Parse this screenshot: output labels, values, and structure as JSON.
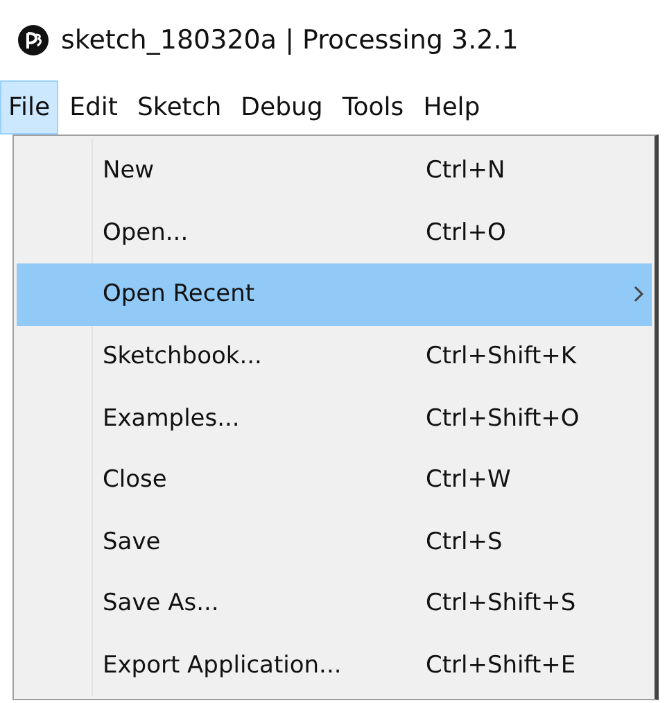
{
  "window": {
    "title": "sketch_180320a | Processing 3.2.1"
  },
  "menubar": [
    {
      "label": "File",
      "selected": true
    },
    {
      "label": "Edit",
      "selected": false
    },
    {
      "label": "Sketch",
      "selected": false
    },
    {
      "label": "Debug",
      "selected": false
    },
    {
      "label": "Tools",
      "selected": false
    },
    {
      "label": "Help",
      "selected": false
    }
  ],
  "menu": [
    {
      "label": "New",
      "shortcut": "Ctrl+N",
      "selected": false,
      "submenu": false
    },
    {
      "label": "Open...",
      "shortcut": "Ctrl+O",
      "selected": false,
      "submenu": false
    },
    {
      "label": "Open Recent",
      "selected": true,
      "submenu": true
    },
    {
      "label": "Sketchbook...",
      "shortcut": "Ctrl+Shift+K",
      "selected": false,
      "submenu": false
    },
    {
      "label": "Examples...",
      "shortcut": "Ctrl+Shift+O",
      "selected": false,
      "submenu": false
    },
    {
      "label": "Close",
      "shortcut": "Ctrl+W",
      "selected": false,
      "submenu": false
    },
    {
      "label": "Save",
      "shortcut": "Ctrl+S",
      "selected": false,
      "submenu": false
    },
    {
      "label": "Save As...",
      "shortcut": "Ctrl+Shift+S",
      "selected": false,
      "submenu": false
    },
    {
      "label": "Export Application...",
      "shortcut": "Ctrl+Shift+E",
      "selected": false,
      "submenu": false
    }
  ]
}
